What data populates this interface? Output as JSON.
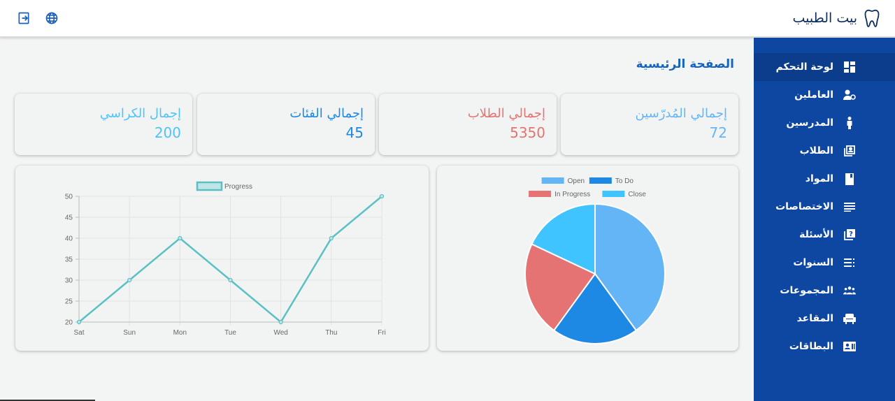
{
  "header": {
    "brand": "بيت الطبيب",
    "logout_icon": "logout-icon",
    "language_icon": "globe-icon",
    "brand_icon": "tooth-icon"
  },
  "sidebar": {
    "items": [
      {
        "label": "لوحة التحكم",
        "icon": "dashboard-icon",
        "active": true
      },
      {
        "label": "العاملين",
        "icon": "user-gear-icon"
      },
      {
        "label": "المدرسين",
        "icon": "person-icon"
      },
      {
        "label": "الطلاب",
        "icon": "student-icon"
      },
      {
        "label": "المواد",
        "icon": "book-icon"
      },
      {
        "label": "الاختصاصات",
        "icon": "lines-icon"
      },
      {
        "label": "الأسئلة",
        "icon": "question-icon"
      },
      {
        "label": "السنوات",
        "icon": "list-icon"
      },
      {
        "label": "المجموعات",
        "icon": "groups-icon"
      },
      {
        "label": "المقاعد",
        "icon": "seat-icon"
      },
      {
        "label": "البطاقات",
        "icon": "card-icon"
      }
    ]
  },
  "main": {
    "title": "الصفحة الرئيسية",
    "cards": [
      {
        "label": "إجمالي المُدرّسين",
        "value": "72",
        "color": "#64b5f6"
      },
      {
        "label": "إجمالي الطلاب",
        "value": "5350",
        "color": "#e57373"
      },
      {
        "label": "إجمالي الفئات",
        "value": "45",
        "color": "#1e88e5"
      },
      {
        "label": "إجمال الكراسي",
        "value": "200",
        "color": "#4fc3f7"
      }
    ]
  },
  "colors": {
    "sidebar_bg": "#0d47a1",
    "accent": "#1565c0",
    "line": "#5bc0c4"
  },
  "chart_data": [
    {
      "type": "line",
      "categories": [
        "Sat",
        "Sun",
        "Mon",
        "Tue",
        "Wed",
        "Thu",
        "Fri"
      ],
      "series": [
        {
          "name": "Progress",
          "values": [
            20,
            30,
            40,
            30,
            20,
            40,
            50
          ],
          "color": "#5bc0c4"
        }
      ],
      "ylim": [
        20,
        50
      ],
      "yticks": [
        "20",
        "25",
        "30",
        "35",
        "40",
        "45",
        "50"
      ],
      "grid": true,
      "legend": "top"
    },
    {
      "type": "pie",
      "labels": [
        "Open",
        "To Do",
        "In Progress",
        "Close"
      ],
      "values": [
        40,
        20,
        22,
        18
      ],
      "colors": [
        "#64b5f6",
        "#1e88e5",
        "#e57373",
        "#40c4ff"
      ],
      "legend": "top"
    }
  ]
}
